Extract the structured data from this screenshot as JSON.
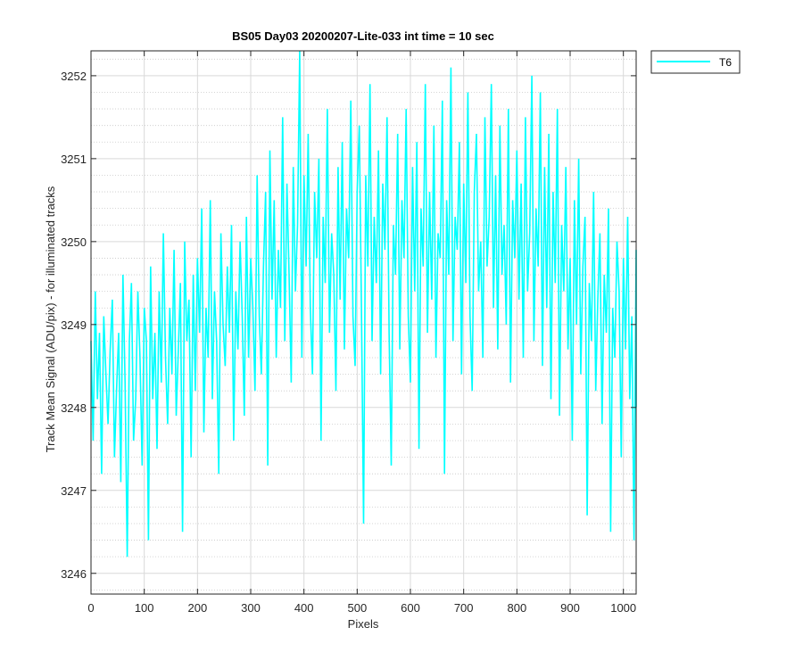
{
  "chart_data": {
    "type": "line",
    "title": "BS05 Day03 20200207-Lite-033 int time = 10 sec",
    "xlabel": "Pixels",
    "ylabel": "Track Mean Signal (ADU/pix) - for illuminated tracks",
    "xlim": [
      0,
      1024
    ],
    "ylim": [
      3245.75,
      3252.3
    ],
    "xticks": [
      0,
      100,
      200,
      300,
      400,
      500,
      600,
      700,
      800,
      900,
      1000
    ],
    "yticks": [
      3246,
      3247,
      3248,
      3249,
      3250,
      3251,
      3252
    ],
    "grid": true,
    "minor_grid": true,
    "legend_position": "outside top-right",
    "series": [
      {
        "name": "T6",
        "color": "#00FFFF",
        "x_start": 0,
        "x_step": 4,
        "values": [
          3248.8,
          3247.6,
          3249.4,
          3248.1,
          3248.9,
          3247.2,
          3249.1,
          3248.4,
          3247.8,
          3248.7,
          3249.3,
          3247.4,
          3248.2,
          3248.9,
          3247.1,
          3249.6,
          3248.3,
          3246.2,
          3248.8,
          3249.5,
          3247.6,
          3248.1,
          3249.4,
          3248.6,
          3247.3,
          3249.2,
          3248.8,
          3246.4,
          3249.7,
          3248.1,
          3248.9,
          3247.5,
          3249.4,
          3248.3,
          3250.1,
          3248.6,
          3247.8,
          3249.2,
          3248.4,
          3249.9,
          3247.9,
          3248.7,
          3249.5,
          3246.5,
          3250.0,
          3248.8,
          3249.3,
          3247.4,
          3249.6,
          3248.2,
          3249.8,
          3248.9,
          3250.4,
          3247.7,
          3249.2,
          3248.6,
          3250.5,
          3248.1,
          3249.4,
          3248.8,
          3247.2,
          3250.1,
          3249.0,
          3248.5,
          3249.7,
          3248.9,
          3250.2,
          3247.6,
          3249.4,
          3248.7,
          3250.0,
          3249.1,
          3247.9,
          3250.3,
          3248.6,
          3249.8,
          3249.2,
          3248.2,
          3250.8,
          3249.1,
          3248.4,
          3249.7,
          3250.6,
          3247.3,
          3251.1,
          3249.3,
          3250.5,
          3248.6,
          3249.9,
          3249.2,
          3251.5,
          3248.8,
          3250.7,
          3249.6,
          3248.3,
          3250.9,
          3249.4,
          3250.2,
          3252.3,
          3248.6,
          3250.8,
          3249.7,
          3251.3,
          3249.2,
          3248.4,
          3250.6,
          3249.8,
          3251.0,
          3247.6,
          3250.3,
          3249.5,
          3251.6,
          3248.9,
          3250.1,
          3249.6,
          3248.2,
          3250.9,
          3249.3,
          3251.2,
          3248.7,
          3250.4,
          3249.8,
          3251.7,
          3249.1,
          3248.5,
          3250.6,
          3251.4,
          3249.2,
          3246.6,
          3250.8,
          3249.7,
          3251.9,
          3248.8,
          3250.3,
          3249.5,
          3251.1,
          3248.4,
          3250.7,
          3249.9,
          3251.5,
          3248.9,
          3247.3,
          3250.2,
          3249.6,
          3251.3,
          3248.7,
          3250.5,
          3249.8,
          3251.6,
          3249.1,
          3248.3,
          3250.9,
          3249.4,
          3251.2,
          3247.5,
          3250.4,
          3249.7,
          3251.9,
          3248.9,
          3250.6,
          3249.3,
          3251.4,
          3248.6,
          3250.1,
          3249.8,
          3251.7,
          3247.2,
          3250.5,
          3249.6,
          3252.1,
          3248.8,
          3250.3,
          3249.9,
          3251.2,
          3248.4,
          3250.7,
          3249.5,
          3251.8,
          3249.1,
          3248.2,
          3250.6,
          3251.3,
          3249.4,
          3250.0,
          3248.6,
          3251.5,
          3249.7,
          3250.3,
          3251.9,
          3249.2,
          3250.8,
          3248.7,
          3251.4,
          3249.6,
          3250.2,
          3249.0,
          3251.6,
          3248.3,
          3250.5,
          3249.8,
          3251.1,
          3249.3,
          3250.7,
          3248.6,
          3251.5,
          3249.4,
          3250.1,
          3252.0,
          3248.8,
          3250.4,
          3249.7,
          3251.8,
          3248.5,
          3250.9,
          3249.2,
          3251.3,
          3248.1,
          3250.6,
          3249.5,
          3251.6,
          3247.9,
          3250.2,
          3249.4,
          3250.9,
          3248.7,
          3249.8,
          3247.6,
          3250.5,
          3249.0,
          3251.0,
          3248.4,
          3249.7,
          3250.3,
          3246.7,
          3249.5,
          3248.8,
          3250.6,
          3248.2,
          3249.3,
          3250.1,
          3247.8,
          3249.6,
          3248.9,
          3250.4,
          3246.5,
          3249.2,
          3248.6,
          3250.0,
          3249.4,
          3247.4,
          3249.8,
          3248.7,
          3250.3,
          3248.1,
          3249.1,
          3246.4,
          3249.9,
          3248.5,
          3249.6,
          3248.0
        ]
      }
    ]
  }
}
